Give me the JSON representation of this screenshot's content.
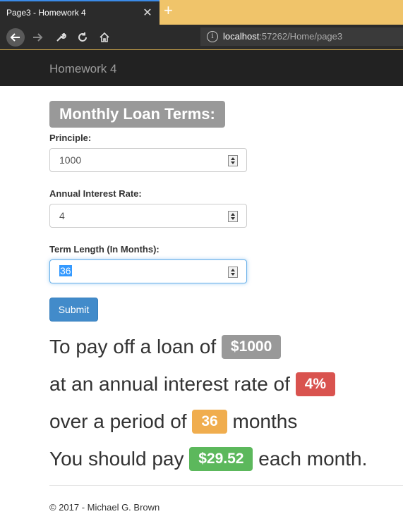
{
  "browser": {
    "tab_title": "Page3 - Homework 4",
    "tab_close": "✕",
    "new_tab": "+",
    "url_host": "localhost",
    "url_rest": ":57262/Home/page3"
  },
  "site": {
    "brand": "Homework 4"
  },
  "form": {
    "heading": "Monthly Loan Terms:",
    "principle_label": "Principle:",
    "principle_value": "1000",
    "rate_label": "Annual Interest Rate:",
    "rate_value": "4",
    "term_label": "Term Length (In Months):",
    "term_value": "36",
    "submit_label": "Submit"
  },
  "result": {
    "line1_text": "To pay off a loan of",
    "amount": "$1000",
    "line2_text": "at an annual interest rate of",
    "rate": "4%",
    "line3_text": "over a period of",
    "months": "36",
    "line3_suffix": "months",
    "line4_text": "You should pay",
    "payment": "$29.52",
    "line4_suffix": "each month."
  },
  "footer": {
    "text": "© 2017 - Michael G. Brown"
  }
}
